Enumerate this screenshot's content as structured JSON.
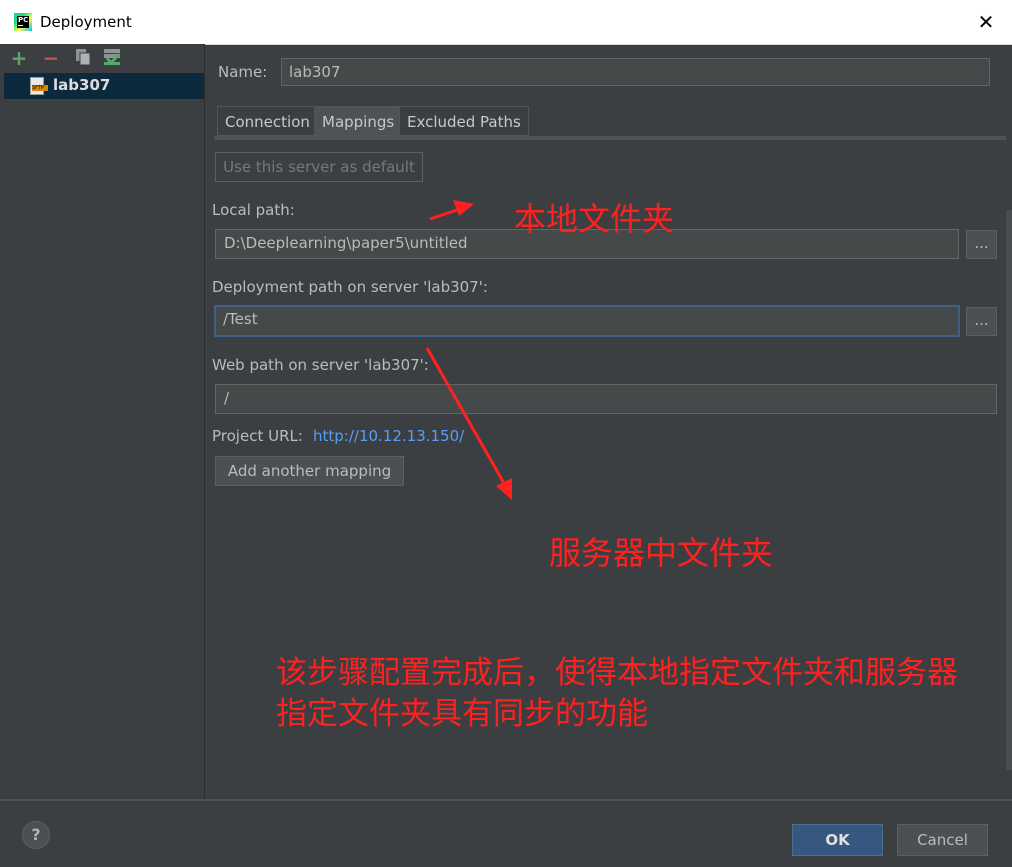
{
  "window": {
    "title": "Deployment",
    "close_glyph": "✕"
  },
  "app_icon": {
    "text": "PC"
  },
  "toolbar": {
    "add_glyph": "+",
    "remove_glyph": "−",
    "copy_icon": "copy-icon",
    "default_icon": "set-default-icon"
  },
  "tree": {
    "items": [
      {
        "label": "lab307",
        "icon": "sftp-server-icon",
        "icon_text": "SFTP"
      }
    ]
  },
  "form": {
    "name_label": "Name:",
    "name_value": "lab307",
    "tabs": [
      {
        "label": "Connection"
      },
      {
        "label": "Mappings",
        "active": true
      },
      {
        "label": "Excluded Paths"
      }
    ],
    "default_button": "Use this server as default",
    "local_path_label": "Local path:",
    "local_path_value": "D:\\Deeplearning\\paper5\\untitled",
    "browse_label": "...",
    "deploy_path_label": "Deployment path on server 'lab307':",
    "deploy_path_value": "/Test",
    "web_path_label": "Web path on server 'lab307':",
    "web_path_value": "/",
    "project_url_label": "Project URL:",
    "project_url_value": "http://10.12.13.150/",
    "add_mapping_button": "Add another mapping"
  },
  "annotations": {
    "local_folder": "本地文件夹",
    "server_folder": "服务器中文件夹",
    "note_line1": "该步骤配置完成后，使得本地指定文件夹和服务器",
    "note_line2": "指定文件夹具有同步的功能",
    "color": "#ff2020"
  },
  "footer": {
    "help_label": "?",
    "ok_label": "OK",
    "cancel_label": "Cancel"
  },
  "colors": {
    "background": "#3c3f41",
    "selection": "#0d293e",
    "link": "#589df6",
    "focus": "#3d6185",
    "ok": "#365880"
  }
}
